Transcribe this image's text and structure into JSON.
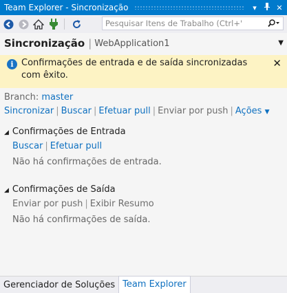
{
  "window": {
    "title": "Team Explorer - Sincronização",
    "dropdown_glyph": "▾",
    "pin_glyph": "ᵖ",
    "close_glyph": "✕"
  },
  "toolbar": {
    "icons": [
      "back-icon",
      "forward-icon",
      "home-icon",
      "plug-icon",
      "refresh-icon"
    ],
    "search": {
      "placeholder": "Pesquisar Itens de Trabalho (Ctrl+'",
      "value": ""
    }
  },
  "header": {
    "title": "Sincronização",
    "project": "WebApplication1"
  },
  "notice": {
    "message": "Confirmações de entrada e de saída sincronizadas com êxito."
  },
  "branch": {
    "label": "Branch:",
    "name": "master"
  },
  "actions": {
    "sync": "Sincronizar",
    "fetch": "Buscar",
    "pull": "Efetuar pull",
    "push": "Enviar por push",
    "more": "Ações"
  },
  "incoming": {
    "title": "Confirmações de Entrada",
    "fetch": "Buscar",
    "pull": "Efetuar pull",
    "empty": "Não há confirmações de entrada."
  },
  "outgoing": {
    "title": "Confirmações de Saída",
    "push": "Enviar por push",
    "summary": "Exibir Resumo",
    "empty": "Não há confirmações de saída."
  },
  "bottom_tabs": [
    {
      "label": "Gerenciador de Soluções",
      "active": false
    },
    {
      "label": "Team Explorer",
      "active": true
    }
  ],
  "colors": {
    "accent": "#007acc",
    "link": "#0e70c0",
    "notice_bg": "#fdf3c4",
    "info_icon": "#1a73c5"
  }
}
